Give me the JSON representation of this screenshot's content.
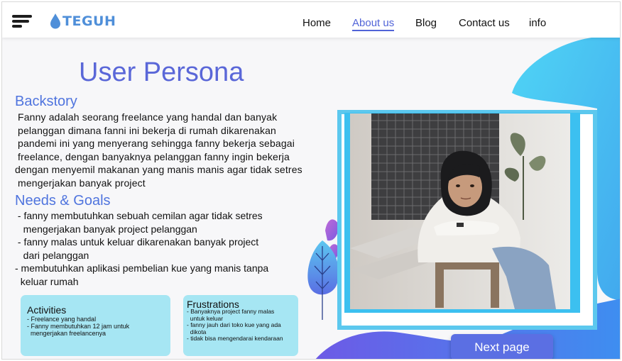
{
  "header": {
    "logo_text": "TEGUH",
    "nav": [
      {
        "label": "Home"
      },
      {
        "label": "About us"
      },
      {
        "label": "Blog"
      },
      {
        "label": "Contact us"
      },
      {
        "label": "info"
      }
    ]
  },
  "page": {
    "title": "User Persona",
    "backstory": {
      "heading": "Backstory",
      "lines": [
        " Fanny adalah seorang freelance yang handal dan banyak",
        " pelanggan dimana fanni ini bekerja di rumah dikarenakan",
        " pandemi ini yang menyerang sehingga fanny bekerja sebagai",
        " freelance, dengan banyaknya pelanggan fanny ingin bekerja",
        "dengan menyemil makanan yang manis manis agar tidak setres",
        " mengerjakan banyak project"
      ]
    },
    "needs": {
      "heading": "Needs & Goals",
      "lines": [
        " - fanny membutuhkan sebuah cemilan agar tidak setres",
        "   mengerjakan banyak project pelanggan",
        " - fanny malas untuk keluar dikarenakan banyak project",
        "   dari pelanggan",
        "- membutuhkan aplikasi pembelian kue yang manis tanpa",
        "  keluar rumah"
      ]
    },
    "activities": {
      "heading": "Activities",
      "lines": [
        "- Freelance yang handal",
        "- Fanny membutuhkan 12 jam untuk",
        "  mengerjakan freelancenya"
      ]
    },
    "frustrations": {
      "heading": "Frustrations",
      "lines": [
        "- Banyaknya project fanny malas",
        "  untuk keluar",
        "- fanny jauh dari toko kue yang ada",
        "  dikota",
        "- tidak bisa mengendarai kendaraan"
      ]
    },
    "next_button": "Next page"
  },
  "colors": {
    "accent": "#5b6fe3",
    "title": "#5a67d8",
    "card": "#a6e6f3",
    "blob": "#4fd0f3"
  }
}
